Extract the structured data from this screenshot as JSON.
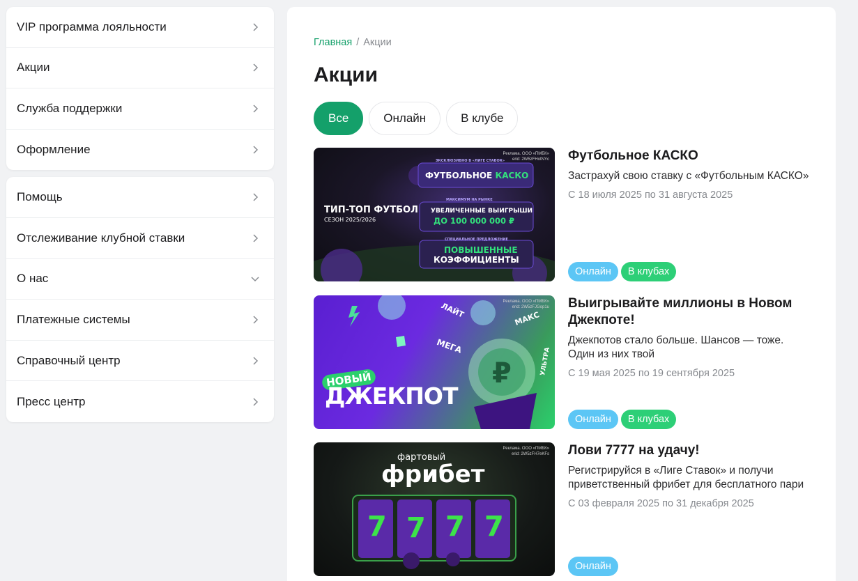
{
  "sidebar": {
    "group1": [
      "VIP программа лояльности",
      "Акции",
      "Служба поддержки",
      "Оформление"
    ],
    "group2": [
      "Помощь",
      "Отслеживание клубной ставки",
      "О нас",
      "Платежные системы",
      "Справочный центр",
      "Пресс центр"
    ]
  },
  "breadcrumb": {
    "home": "Главная",
    "separator": "/",
    "current": "Акции"
  },
  "page_title": "Акции",
  "filters": [
    "Все",
    "Онлайн",
    "В клубе"
  ],
  "promos": [
    {
      "title": "Футбольное КАСКО",
      "description": "Застрахуй свою ставку с «Футбольным КАСКО»",
      "dates": "С 18 июля 2025 по 31 августа 2025",
      "tags": [
        "Онлайн",
        "В клубах"
      ],
      "banner": {
        "ad_note_1": "Реклама. ООО «ПМБК»",
        "ad_note_2": "erid: 2W5zFHotNYc",
        "headline": "ТИП-ТОП ФУТБОЛ",
        "season": "СЕЗОН 2025/2026",
        "exclusive": "ЭКСКЛЮЗИВНО В «ЛИГЕ СТАВОК»",
        "kasko_1": "ФУТБОЛЬНОЕ",
        "kasko_2": "КАСКО",
        "max_label": "МАКСИМУМ НА РЫНКЕ",
        "wins_1": "УВЕЛИЧЕННЫЕ ВЫИГРЫШИ",
        "wins_2": "ДО 100 000 000 ₽",
        "special": "СПЕЦИАЛЬНОЕ ПРЕДЛОЖЕНИЕ",
        "odds_1": "ПОВЫШЕННЫЕ",
        "odds_2": "КОЭФФИЦИЕНТЫ"
      }
    },
    {
      "title": "Выигрывайте миллионы в Новом Джекпоте!",
      "description": "Джекпотов стало больше. Шансов — тоже. Один из них твой",
      "dates": "С 19 мая 2025 по 19 сентября 2025",
      "tags": [
        "Онлайн",
        "В клубах"
      ],
      "banner": {
        "ad_note_1": "Реклама. ООО «ПМБК»",
        "ad_note_2": "erid: 2W5zFJGop1u",
        "new": "НОВЫЙ",
        "jackpot": "ДЖЕКПОТ",
        "lite": "ЛАЙТ",
        "mega": "МЕГА",
        "maks": "МАКС",
        "ultra": "УЛЬТРА"
      }
    },
    {
      "title": "Лови 7777 на удачу!",
      "description": "Регистрируйся в «Лиге Ставок» и получи приветственный фрибет для бесплатного пари",
      "dates": "С 03 февраля 2025 по 31 декабря 2025",
      "tags": [
        "Онлайн"
      ],
      "banner": {
        "ad_note_1": "Реклама. ООО «ПМБК»",
        "ad_note_2": "erid: 2W5zFH7eKFs",
        "lucky": "фартовый",
        "freebet": "фрибет",
        "sevens": [
          "7",
          "7",
          "7",
          "7"
        ]
      }
    }
  ],
  "colors": {
    "accent": "#14a06a",
    "online_tag": "#5cc6f5",
    "club_tag": "#2dcf77"
  }
}
